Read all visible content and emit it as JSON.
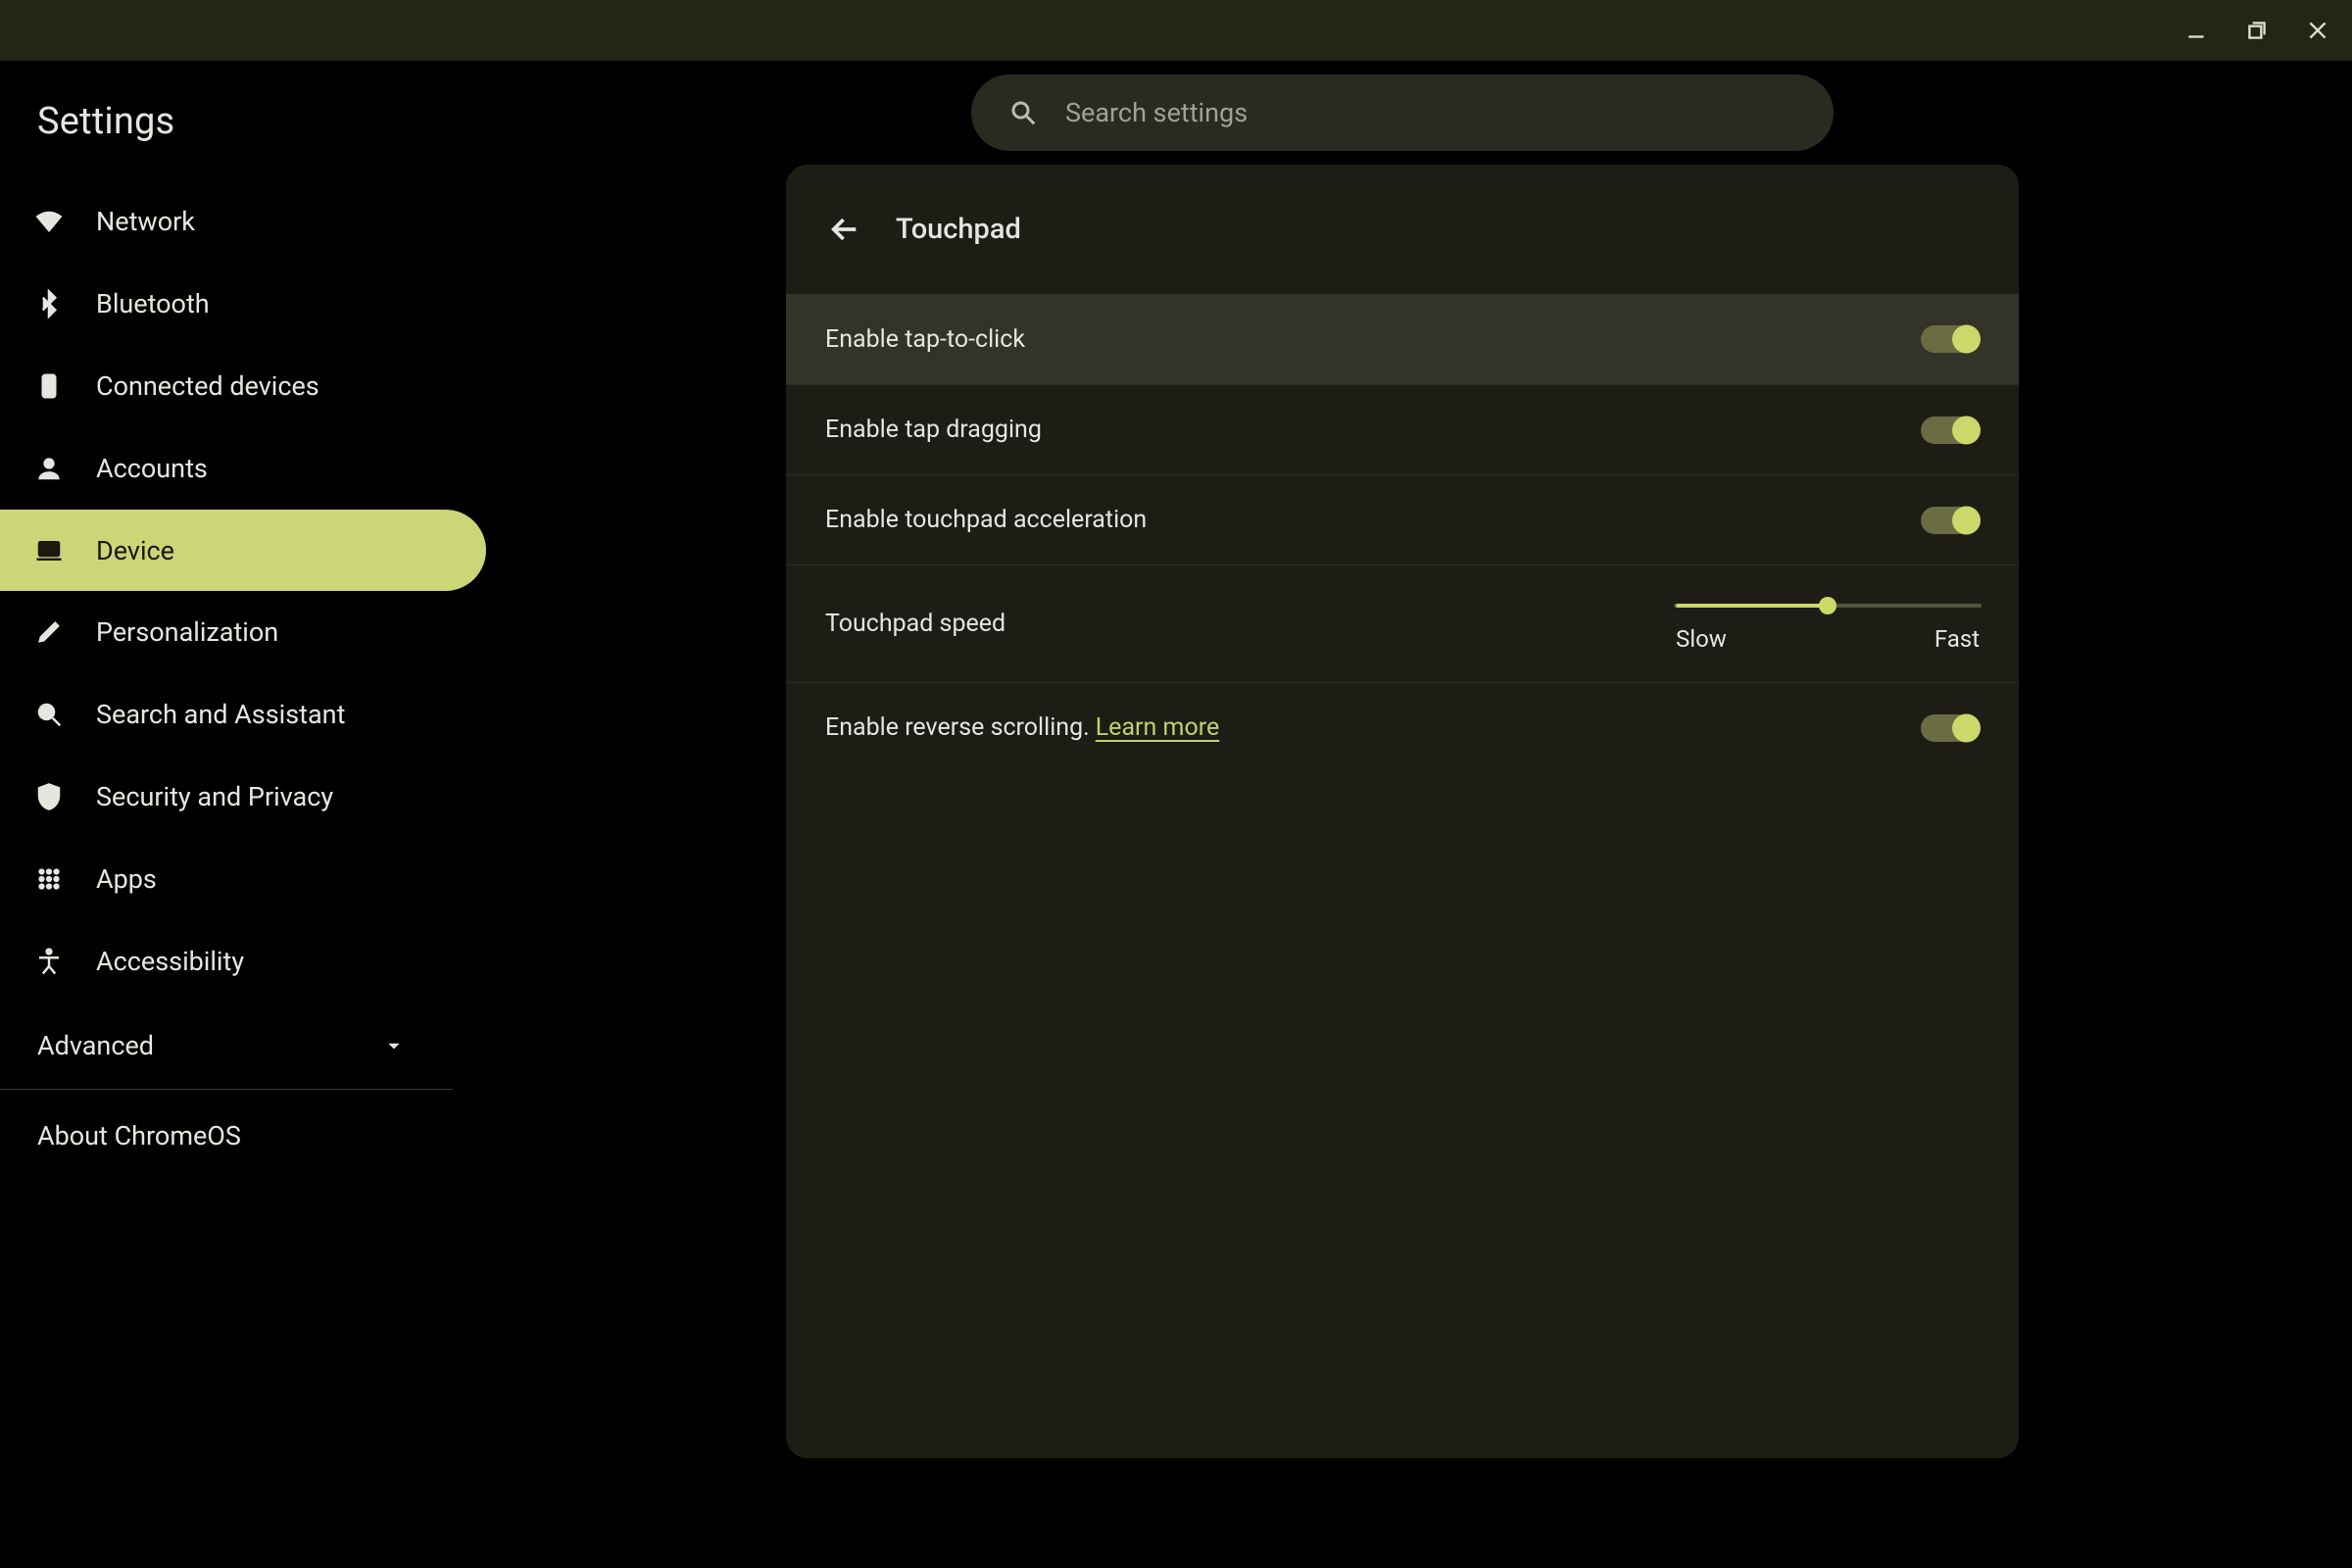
{
  "app_title": "Settings",
  "search": {
    "placeholder": "Search settings"
  },
  "sidebar": {
    "items": [
      {
        "label": "Network"
      },
      {
        "label": "Bluetooth"
      },
      {
        "label": "Connected devices"
      },
      {
        "label": "Accounts"
      },
      {
        "label": "Device"
      },
      {
        "label": "Personalization"
      },
      {
        "label": "Search and Assistant"
      },
      {
        "label": "Security and Privacy"
      },
      {
        "label": "Apps"
      },
      {
        "label": "Accessibility"
      }
    ],
    "selected_index": 4,
    "advanced_label": "Advanced",
    "about_label": "About ChromeOS"
  },
  "page": {
    "title": "Touchpad",
    "rows": {
      "tap_to_click": {
        "label": "Enable tap-to-click",
        "on": true,
        "highlighted": true
      },
      "tap_dragging": {
        "label": "Enable tap dragging",
        "on": true
      },
      "acceleration": {
        "label": "Enable touchpad acceleration",
        "on": true
      },
      "speed": {
        "label": "Touchpad speed",
        "slow": "Slow",
        "fast": "Fast",
        "value": 0.5
      },
      "reverse_scroll": {
        "label_pre": "Enable reverse scrolling. ",
        "link": "Learn more",
        "on": true
      }
    }
  }
}
